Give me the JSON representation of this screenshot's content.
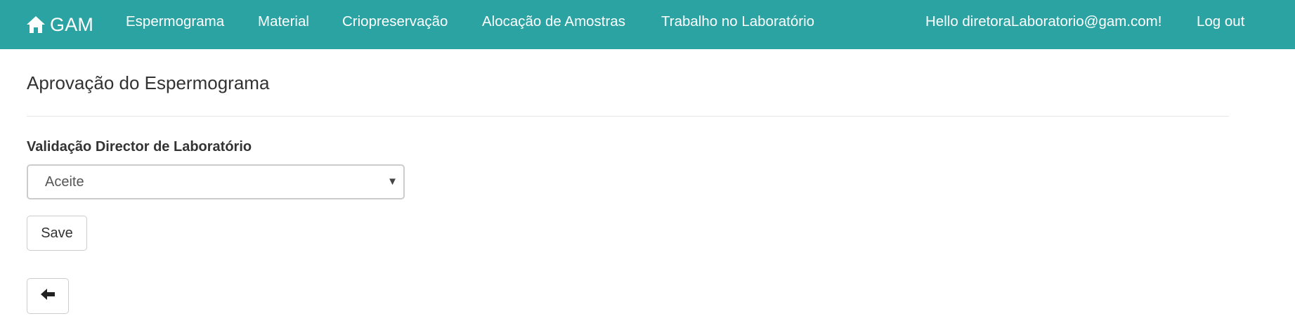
{
  "navbar": {
    "brand": {
      "icon": "home-icon",
      "label": "GAM"
    },
    "links": [
      "Espermograma",
      "Material",
      "Criopreservação",
      "Alocação de Amostras",
      "Trabalho no Laboratório"
    ],
    "greeting": "Hello diretoraLaboratorio@gam.com!",
    "logout_label": "Log out",
    "background_color": "#2ba3a3"
  },
  "page": {
    "title": "Aprovação do Espermograma"
  },
  "form": {
    "validation_label": "Validação Director de Laboratório",
    "validation_selected": "Aceite",
    "save_label": "Save"
  },
  "back_button": {
    "icon": "arrow-left-icon"
  }
}
